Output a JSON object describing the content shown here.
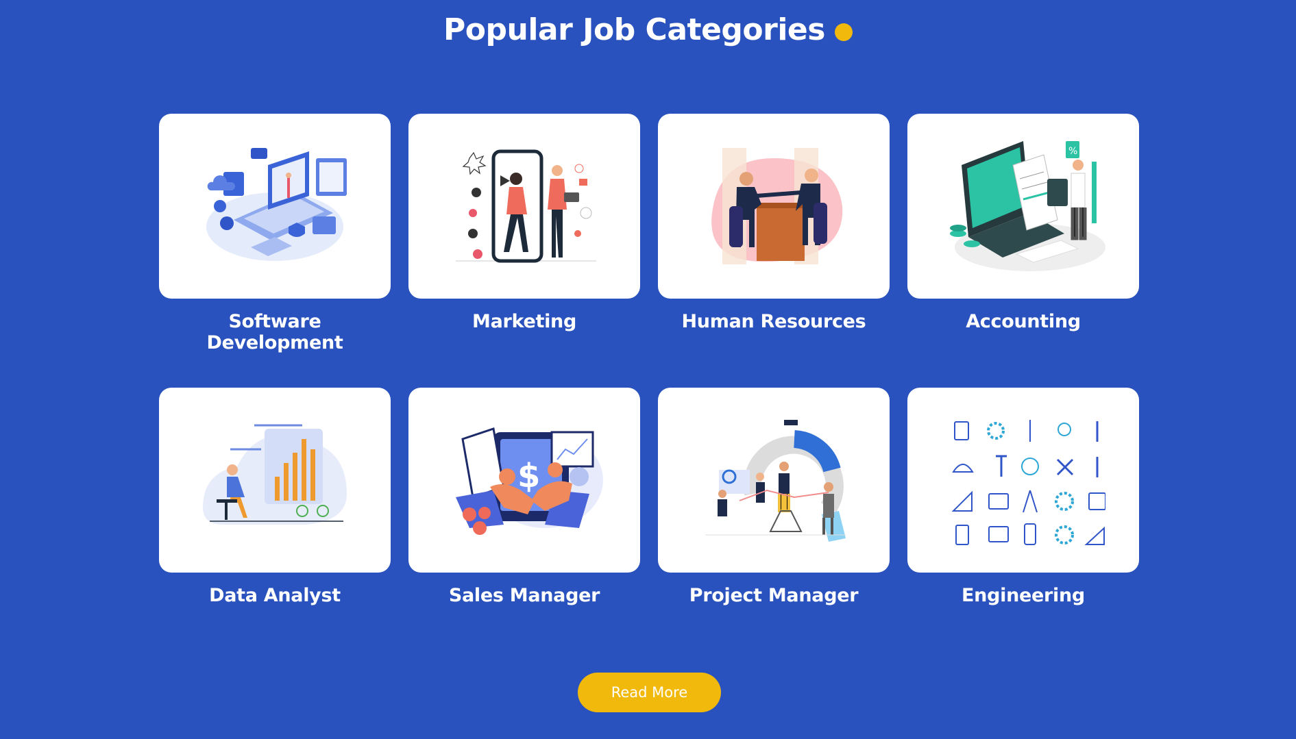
{
  "header": {
    "title": "Popular Job Categories"
  },
  "categories": [
    {
      "label": "Software Development",
      "icon": "software-development-illustration-icon"
    },
    {
      "label": "Marketing",
      "icon": "marketing-illustration-icon"
    },
    {
      "label": "Human Resources",
      "icon": "human-resources-illustration-icon"
    },
    {
      "label": "Accounting",
      "icon": "accounting-illustration-icon"
    },
    {
      "label": "Data Analyst",
      "icon": "data-analyst-illustration-icon"
    },
    {
      "label": "Sales Manager",
      "icon": "sales-manager-illustration-icon"
    },
    {
      "label": "Project Manager",
      "icon": "project-manager-illustration-icon"
    },
    {
      "label": "Engineering",
      "icon": "engineering-illustration-icon"
    }
  ],
  "actions": {
    "read_more_label": "Read More"
  },
  "colors": {
    "background": "#2a52be",
    "accent": "#f2b90d",
    "card": "#ffffff"
  }
}
